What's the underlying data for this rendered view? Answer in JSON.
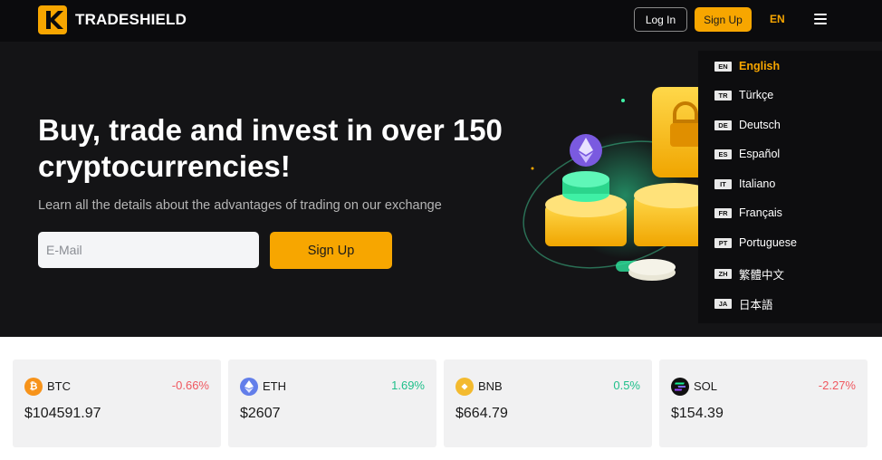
{
  "header": {
    "brand": "TRADESHIELD",
    "login_label": "Log In",
    "signup_label": "Sign Up",
    "language": "EN"
  },
  "hero": {
    "title": "Buy, trade and invest in over 150 cryptocurrencies!",
    "subtitle": "Learn all the details about the advantages of trading on our exchange",
    "email_placeholder": "E-Mail",
    "signup_label": "Sign Up"
  },
  "languages": [
    {
      "code": "EN",
      "name": "English",
      "active": true
    },
    {
      "code": "TR",
      "name": "Türkçe"
    },
    {
      "code": "DE",
      "name": "Deutsch"
    },
    {
      "code": "ES",
      "name": "Español"
    },
    {
      "code": "IT",
      "name": "Italiano"
    },
    {
      "code": "FR",
      "name": "Français"
    },
    {
      "code": "PT",
      "name": "Portuguese"
    },
    {
      "code": "ZH",
      "name": "繁體中文"
    },
    {
      "code": "JA",
      "name": "日本語"
    }
  ],
  "tickers": [
    {
      "symbol": "BTC",
      "change": "-0.66%",
      "price": "$104591.97",
      "icon": "bitcoin-icon",
      "color": "#f7931a"
    },
    {
      "symbol": "ETH",
      "change": "1.69%",
      "price": "$2607",
      "icon": "ethereum-icon",
      "color": "#627eea"
    },
    {
      "symbol": "BNB",
      "change": "0.5%",
      "price": "$664.79",
      "icon": "bnb-icon",
      "color": "#f3ba2f"
    },
    {
      "symbol": "SOL",
      "change": "-2.27%",
      "price": "$154.39",
      "icon": "solana-icon",
      "color": "#111111"
    }
  ],
  "colors": {
    "accent": "#f7a600",
    "negative": "#f0575f",
    "positive": "#1fbf8a"
  }
}
